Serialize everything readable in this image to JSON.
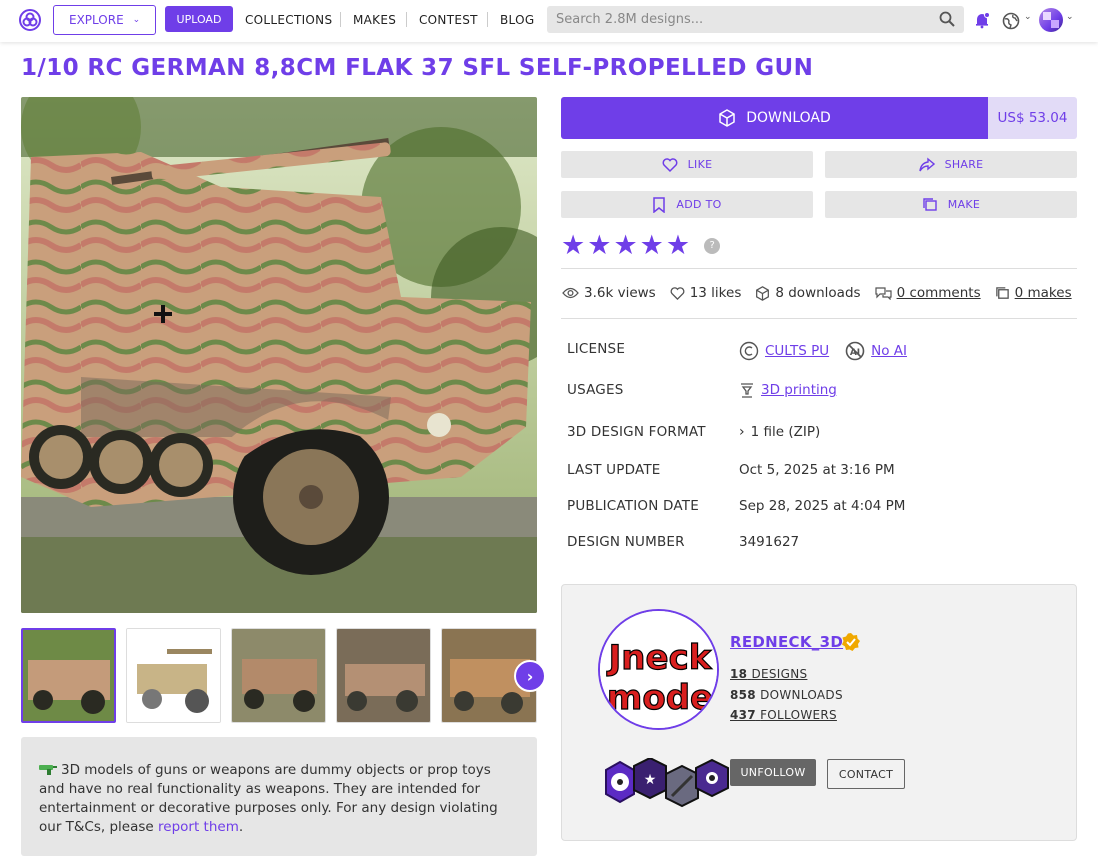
{
  "header": {
    "explore_label": "EXPLORE",
    "upload_label": "UPLOAD",
    "nav": [
      "COLLECTIONS",
      "MAKES",
      "CONTEST",
      "BLOG"
    ],
    "search_placeholder": "Search 2.8M designs...",
    "accent": "#6f3ee8"
  },
  "product": {
    "title": "1/10 RC GERMAN 8,8CM FLAK 37 SFL SELF-PROPELLED GUN",
    "download_label": "DOWNLOAD",
    "price": "US$ 53.04",
    "actions": {
      "like": "LIKE",
      "share": "SHARE",
      "add_to": "ADD TO",
      "make": "MAKE"
    },
    "rating_stars": 5,
    "help_mark": "?",
    "stats": {
      "views": "3.6k views",
      "likes": "13 likes",
      "downloads": "8 downloads",
      "comments": "0 comments",
      "makes": "0 makes"
    },
    "details": {
      "license_label": "LICENSE",
      "license_value": "CULTS PU",
      "ai_value": "No AI",
      "usages_label": "USAGES",
      "usages_value": "3D printing",
      "format_label": "3D DESIGN FORMAT",
      "format_value": "1 file (ZIP)",
      "last_update_label": "LAST UPDATE",
      "last_update_value": "Oct 5, 2025 at 3:16 PM",
      "pub_date_label": "PUBLICATION DATE",
      "pub_date_value": "Sep 28, 2025 at 4:04 PM",
      "design_number_label": "DESIGN NUMBER",
      "design_number_value": "3491627"
    }
  },
  "warning": {
    "text": "3D models of guns or weapons are dummy objects or prop toys and have no real functionality as weapons. They are intended for entertainment or decorative purposes only. For any design violating our T&Cs, please ",
    "link": "report them",
    "end": "."
  },
  "creator": {
    "name": "REDNECK_3D",
    "designs_count": "18",
    "designs_label": "DESIGNS",
    "downloads_count": "858",
    "downloads_label": "DOWNLOADS",
    "followers_count": "437",
    "followers_label": "FOLLOWERS",
    "unfollow_label": "UNFOLLOW",
    "contact_label": "CONTACT",
    "avatar_text_top": "Jneck",
    "avatar_text_bottom": "mode"
  }
}
